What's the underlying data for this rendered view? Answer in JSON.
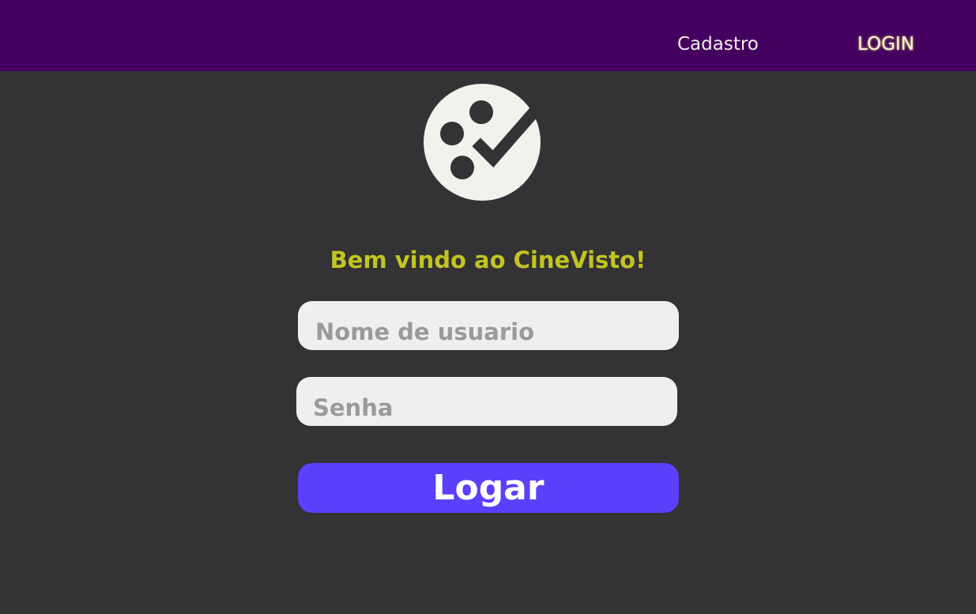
{
  "nav": {
    "cadastro_label": "Cadastro",
    "login_label": "LOGIN"
  },
  "logo": {
    "icon": "film-reel-check-icon"
  },
  "main": {
    "welcome": "Bem vindo ao CineVisto!",
    "username_placeholder": "Nome de usuario",
    "password_placeholder": "Senha",
    "submit_label": "Logar"
  },
  "colors": {
    "topbar": "#440160",
    "background": "#333235",
    "welcome_text": "#c3c421",
    "button": "#5a40fb",
    "field": "#efefef"
  }
}
